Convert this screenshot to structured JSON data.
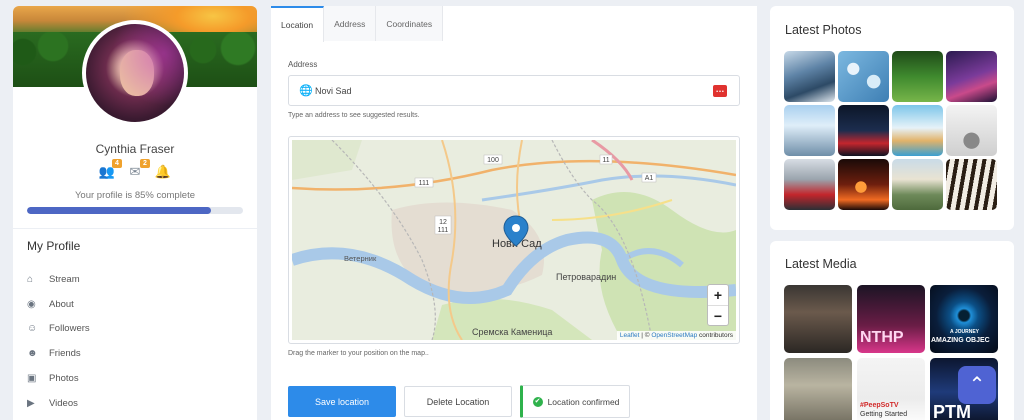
{
  "profile": {
    "name": "Cynthia Fraser",
    "friend_requests": "4",
    "messages": "2",
    "completion_text": "Your profile is 85% complete",
    "completion_percent": 85
  },
  "my_profile": {
    "title": "My Profile",
    "items": [
      {
        "label": "Stream",
        "icon": "home-icon"
      },
      {
        "label": "About",
        "icon": "user-circle-icon"
      },
      {
        "label": "Followers",
        "icon": "user-check-icon"
      },
      {
        "label": "Friends",
        "icon": "users-icon"
      },
      {
        "label": "Photos",
        "icon": "camera-icon"
      },
      {
        "label": "Videos",
        "icon": "video-icon"
      }
    ]
  },
  "location": {
    "tabs": [
      "Location",
      "Address",
      "Coordinates"
    ],
    "active_tab": "Location",
    "address_label": "Address",
    "address_value": "Novi Sad",
    "address_help": "Type an address to see suggested results.",
    "map": {
      "city_label": "Нови Сад",
      "places": [
        "Ветерник",
        "Петроварадин",
        "Сремска Каменица"
      ],
      "road_numbers": [
        "100",
        "111",
        "12",
        "111",
        "11",
        "A1"
      ],
      "zoom_in": "+",
      "zoom_out": "−",
      "attribution_leaflet": "Leaflet",
      "attribution_sep": " | © ",
      "attribution_osm": "OpenStreetMap",
      "attribution_tail": " contributors"
    },
    "map_help": "Drag the marker to your position on the map..",
    "save_label": "Save location",
    "delete_label": "Delete Location",
    "status_label": "Location confirmed",
    "colors": {
      "primary": "#2d8be9",
      "success": "#2fb24c",
      "danger": "#e0322f"
    }
  },
  "latest_photos": {
    "title": "Latest Photos"
  },
  "latest_media": {
    "title": "Latest Media",
    "captions": [
      "NTHP",
      "A JOURNEY",
      "AMAZING OBJEC",
      "#PeepSoTV",
      "Getting Started",
      "PTM"
    ]
  }
}
